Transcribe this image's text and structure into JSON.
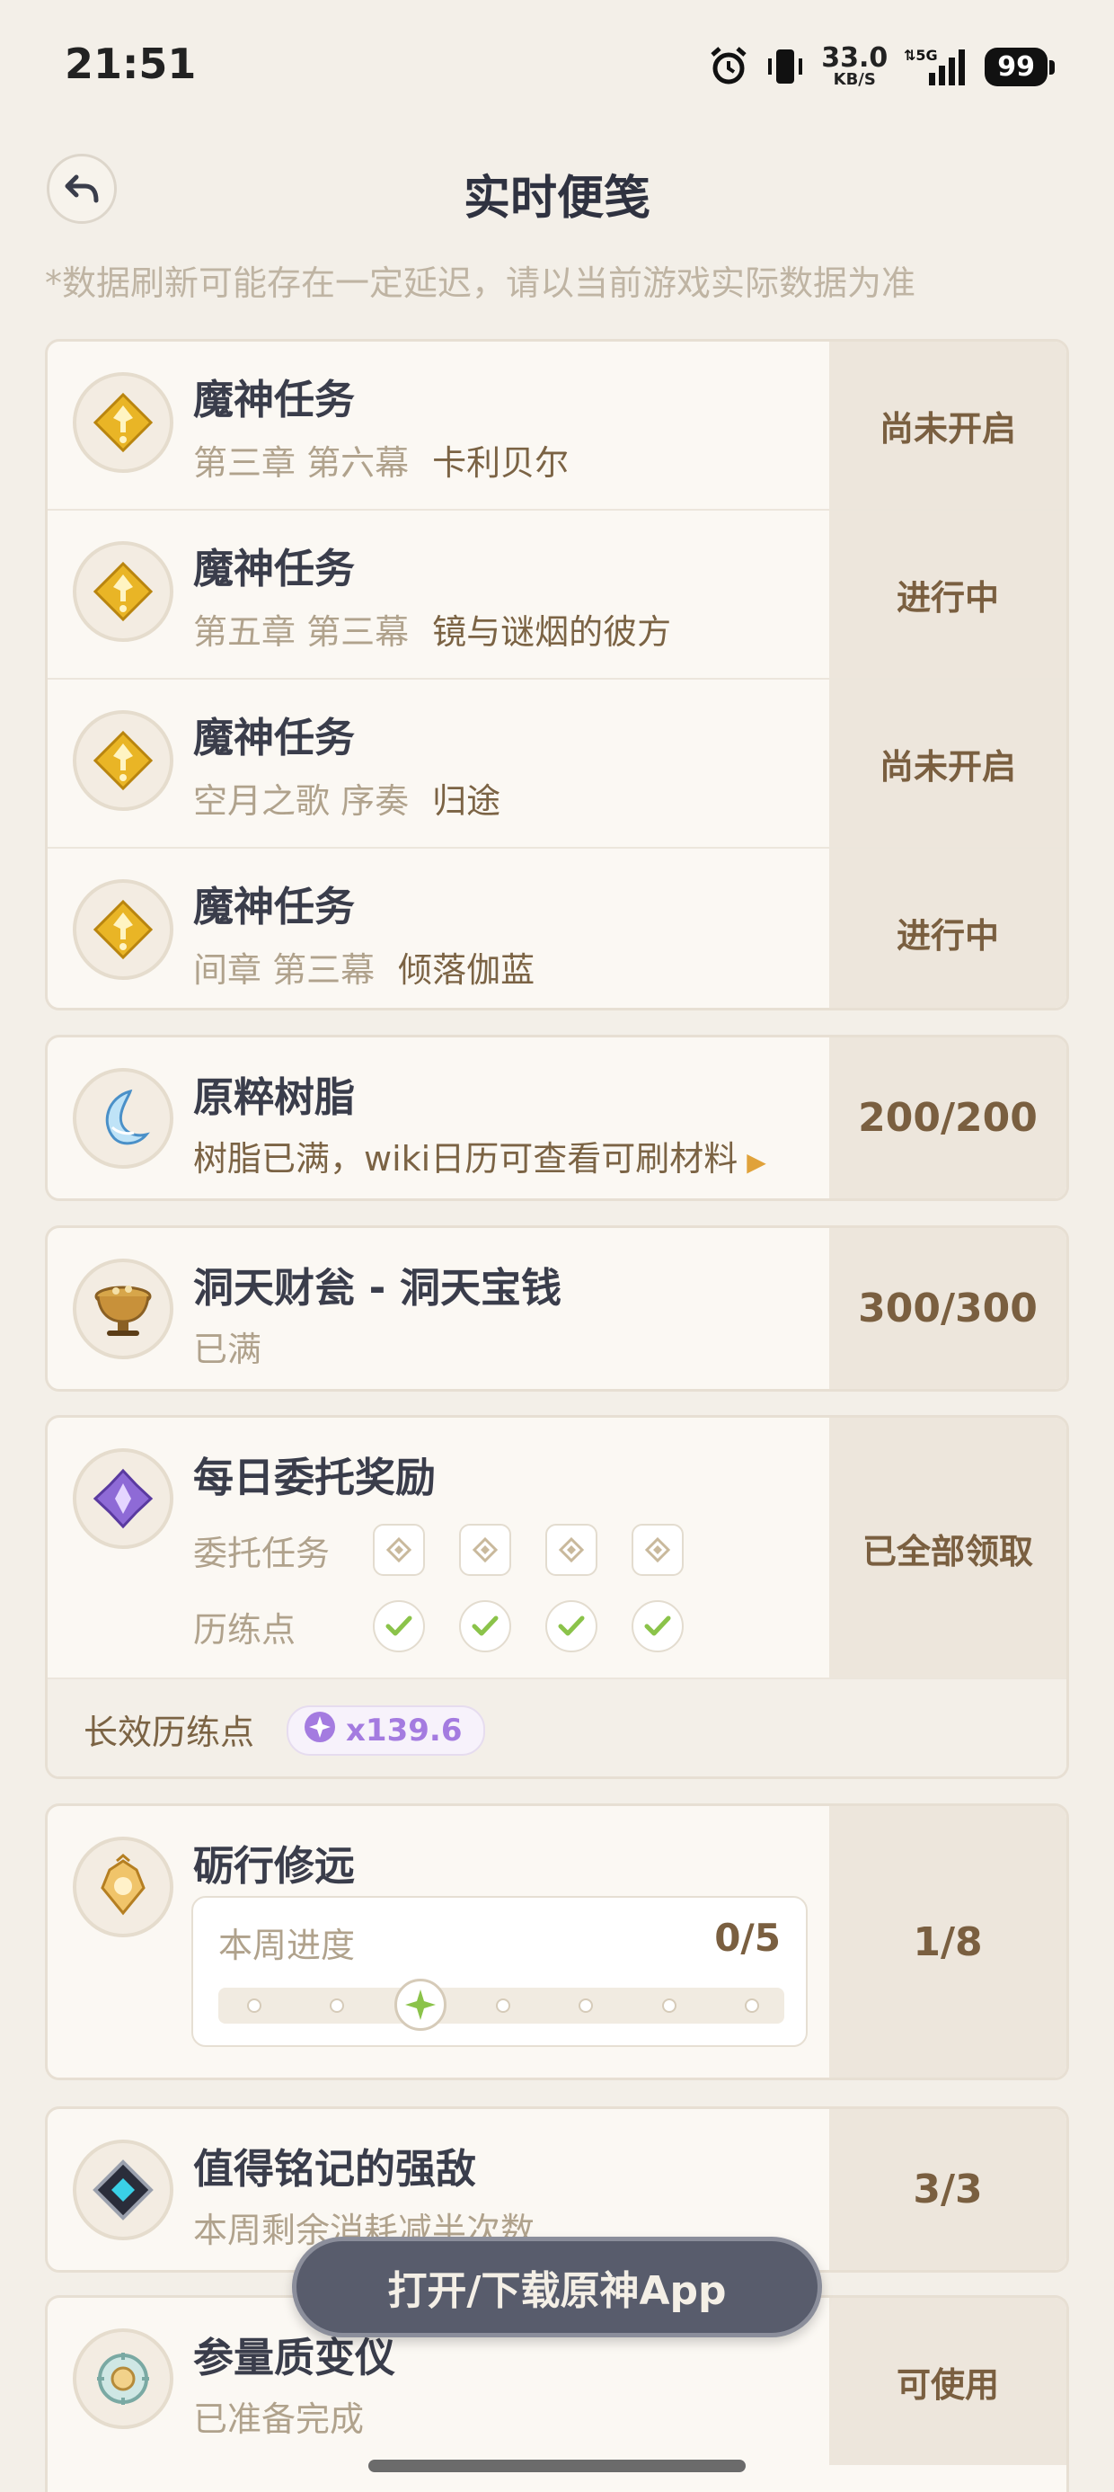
{
  "status_bar": {
    "time": "21:51",
    "net_speed": "33.0",
    "net_unit": "KB/S",
    "signal_label": "5G",
    "battery": "99"
  },
  "header": {
    "title": "实时便笺",
    "notice": "*数据刷新可能存在一定延迟，请以当前游戏实际数据为准"
  },
  "quests": [
    {
      "name": "魔神任务",
      "chapter": "第三章 第六幕",
      "quest_title": "卡利贝尔",
      "status": "尚未开启"
    },
    {
      "name": "魔神任务",
      "chapter": "第五章 第三幕",
      "quest_title": "镜与谜烟的彼方",
      "status": "进行中"
    },
    {
      "name": "魔神任务",
      "chapter": "空月之歌 序奏",
      "quest_title": "归途",
      "status": "尚未开启"
    },
    {
      "name": "魔神任务",
      "chapter": "间章 第三幕",
      "quest_title": "倾落伽蓝",
      "status": "进行中"
    }
  ],
  "resin": {
    "name": "原粹树脂",
    "desc": "树脂已满，wiki日历可查看可刷材料",
    "value": "200/200"
  },
  "realm": {
    "name": "洞天财瓮 - 洞天宝钱",
    "desc": "已满",
    "value": "300/300"
  },
  "commissions": {
    "name": "每日委托奖励",
    "task_label": "委托任务",
    "points_label": "历练点",
    "status": "已全部领取",
    "lasting_label": "长效历练点",
    "lasting_value": "x139.6"
  },
  "weekly": {
    "name": "砺行修远",
    "progress_label": "本周进度",
    "progress_value": "0/5",
    "value": "1/8",
    "active_node": 3,
    "node_count": 7
  },
  "boss": {
    "name": "值得铭记的强敌",
    "desc": "本周剩余消耗减半次数",
    "value": "3/3"
  },
  "transformer": {
    "name": "参量质变仪",
    "desc": "已准备完成",
    "value": "可使用"
  },
  "floating_button": "打开/下载原神App",
  "colors": {
    "background": "#f3efe8",
    "accent_gold": "#7a5f40",
    "check_green": "#8bc34a",
    "purple": "#a47be0"
  }
}
